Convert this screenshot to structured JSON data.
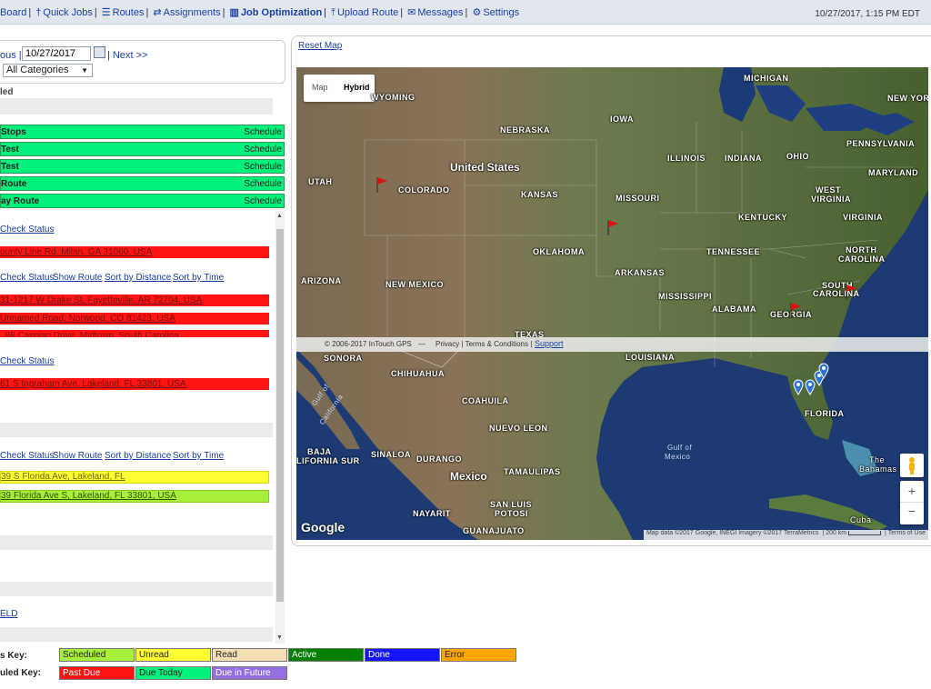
{
  "nav": {
    "items": [
      {
        "label": "Board",
        "icon": "dashboard-icon"
      },
      {
        "label": "Quick Jobs",
        "icon": "map-pin-icon"
      },
      {
        "label": "Routes",
        "icon": "list-icon"
      },
      {
        "label": "Assignments",
        "icon": "exchange-icon"
      },
      {
        "label": "Job Optimization",
        "icon": "map-icon",
        "active": true
      },
      {
        "label": "Upload Route",
        "icon": "upload-icon"
      },
      {
        "label": "Messages",
        "icon": "chat-icon"
      },
      {
        "label": "Settings",
        "icon": "gear-icon"
      }
    ],
    "datetime": "10/27/2017, 1:15 PM EDT"
  },
  "date_nav": {
    "prev_label": "ous |",
    "date_value": "10/27/2017",
    "next_label": "Next >>",
    "next_sep": "|",
    "category_value": "All Categories"
  },
  "left": {
    "section_label": "led",
    "schedule_rows": [
      {
        "name": "Stops",
        "action": "Schedule"
      },
      {
        "name": " Test",
        "action": "Schedule"
      },
      {
        "name": " Test",
        "action": "Schedule"
      },
      {
        "name": "Route",
        "action": "Schedule"
      },
      {
        "name": "ay Route",
        "action": "Schedule"
      }
    ],
    "check_status": "Check Status",
    "show_route": "Show Route",
    "sort_distance": "Sort by Distance",
    "sort_time": "Sort by Time",
    "group1_address": "ounty Line Rd, Milan, GA 31060, USA",
    "group2_addresses": [
      "31-1217 W Drake St, Fayetteville, AR 72704, USA",
      "Unnamed Road, Norwood, CO 81423, USA",
      "..88 Caspian Drive, Midtown, South Carolina"
    ],
    "group3_address": "61 S Ingraham Ave, Lakeland, FL 33801, USA",
    "group4_address_yellow": "39 S Florida Ave, Lakeland, FL",
    "group4_address_lime": "39 Florida Ave S, Lakeland, FL 33801, USA",
    "field_link": "ELD"
  },
  "keys": {
    "status_label": "s Key:",
    "scheduled_label": "uled Key:",
    "status": [
      {
        "label": "Scheduled",
        "color": "#a8ef3c"
      },
      {
        "label": "Unread",
        "color": "#ffff33"
      },
      {
        "label": "Read",
        "color": "#f5deb3"
      },
      {
        "label": "Active",
        "color": "#008000"
      },
      {
        "label": "Done",
        "color": "#1414ff"
      },
      {
        "label": "Error",
        "color": "#ffa500"
      }
    ],
    "schedule": [
      {
        "label": "Past Due",
        "color": "#ff1414"
      },
      {
        "label": "Due Today",
        "color": "#00f07c"
      },
      {
        "label": "Due in Future",
        "color": "#9370db"
      }
    ]
  },
  "map": {
    "reset_label": "Reset Map",
    "type_options": [
      "Map",
      "Hybrid"
    ],
    "type_selected": "Hybrid",
    "labels": {
      "wyoming": "WYOMING",
      "nebraska": "NEBRASKA",
      "iowa": "IOWA",
      "michigan": "MICHIGAN",
      "new_york": "NEW YORK",
      "illinois": "ILLINOIS",
      "indiana": "INDIANA",
      "ohio": "OHIO",
      "pennsylvania": "PENNSYLVANIA",
      "united_states": "United States",
      "utah": "UTAH",
      "colorado": "COLORADO",
      "kansas": "KANSAS",
      "missouri": "MISSOURI",
      "maryland": "MARYLAND",
      "west_virginia_1": "WEST",
      "west_virginia_2": "VIRGINIA",
      "virginia": "VIRGINIA",
      "kentucky": "KENTUCKY",
      "oklahoma": "OKLAHOMA",
      "tennessee": "TENNESSEE",
      "north_carolina_1": "NORTH",
      "north_carolina_2": "CAROLINA",
      "arizona": "ARIZONA",
      "new_mexico": "NEW MEXICO",
      "arkansas": "ARKANSAS",
      "south_carolina_1": "SOUTH",
      "south_carolina_2": "CAROLINA",
      "mississippi": "MISSISSIPPI",
      "alabama": "ALABAMA",
      "georgia": "GEORGIA",
      "texas": "TEXAS",
      "sonora": "SONORA",
      "chihuahua": "CHIHUAHUA",
      "louisiana": "LOUISIANA",
      "coahuila": "COAHUILA",
      "nuevo_leon": "NUEVO LEON",
      "florida": "FLORIDA",
      "gulf_of_california_1": "Gulf of",
      "gulf_of_california_2": "California",
      "baja_1": "BAJA",
      "baja_2": "LIFORNIA SUR",
      "sinaloa": "SINALOA",
      "durango": "DURANGO",
      "tamaulipas": "TAMAULIPAS",
      "mexico": "Mexico",
      "gulf_of_mexico_1": "Gulf of",
      "gulf_of_mexico_2": "Mexico",
      "bahamas_1": "The",
      "bahamas_2": "Bahamas",
      "nayarit": "NAYARIT",
      "san_luis_1": "SAN LUIS",
      "san_luis_2": "POTOSI",
      "guanajuato": "GUANAJUATO",
      "cuba": "Cuba"
    },
    "overlay_copyright": "© 2006-2017 InTouch GPS",
    "overlay_dash": "—",
    "overlay_privacy": "Privacy | Terms & Conditions |",
    "overlay_support": "Support",
    "attribution": "Map data ©2017 Google, INEGI Imagery ©2017 TerraMetrics",
    "scale": "200 km",
    "terms": "Terms of Use",
    "google": "Google",
    "zoom_in": "+",
    "zoom_out": "−"
  }
}
